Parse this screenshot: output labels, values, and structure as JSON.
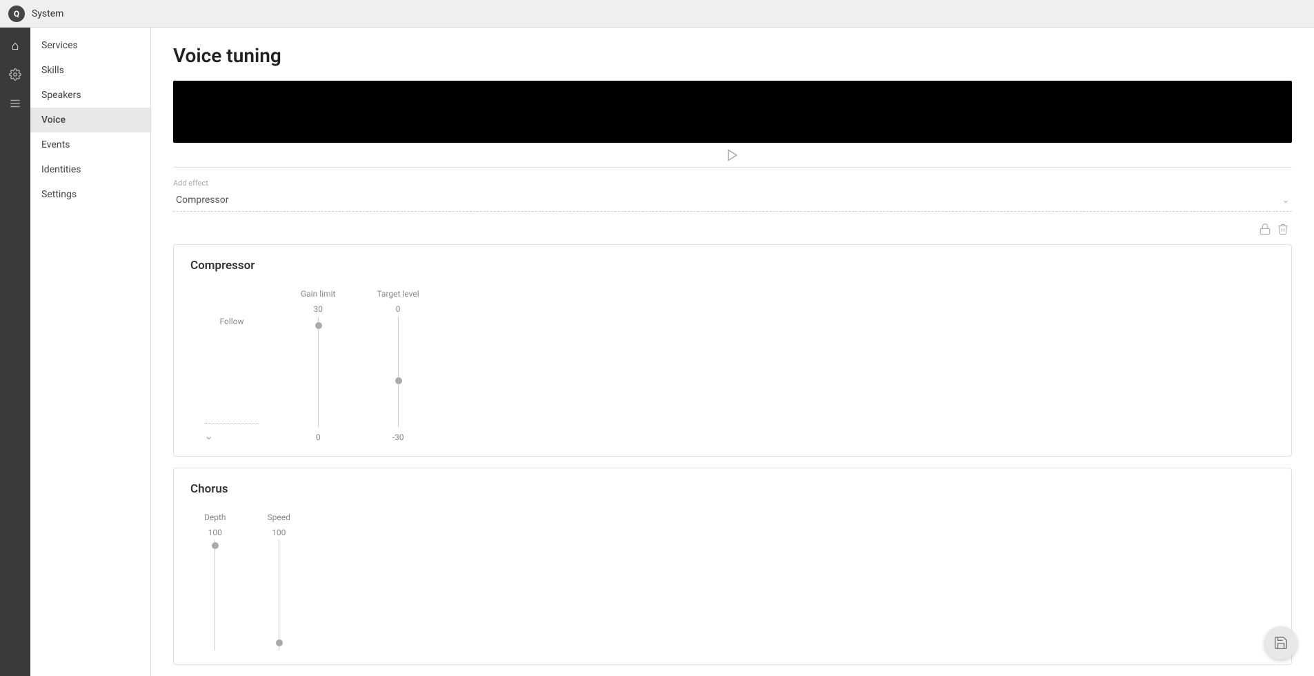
{
  "topbar": {
    "logo": "Q",
    "title": "System"
  },
  "sidebar_icons": [
    {
      "name": "home-icon",
      "symbol": "⌂",
      "active": true
    },
    {
      "name": "skills-icon",
      "symbol": "⚙",
      "active": false
    },
    {
      "name": "menu-icon",
      "symbol": "≡",
      "active": false
    }
  ],
  "nav": {
    "items": [
      {
        "label": "Services",
        "key": "services",
        "active": false
      },
      {
        "label": "Skills",
        "key": "skills",
        "active": false
      },
      {
        "label": "Speakers",
        "key": "speakers",
        "active": false
      },
      {
        "label": "Voice",
        "key": "voice",
        "active": true
      },
      {
        "label": "Events",
        "key": "events",
        "active": false
      },
      {
        "label": "Identities",
        "key": "identities",
        "active": false
      },
      {
        "label": "Settings",
        "key": "settings",
        "active": false
      }
    ]
  },
  "main": {
    "title": "Voice tuning",
    "add_effect_label": "Add effect",
    "add_effect_value": "Compressor",
    "compressor": {
      "title": "Compressor",
      "follow_label": "Follow",
      "gain_limit_label": "Gain limit",
      "gain_limit_top": "30",
      "gain_limit_bottom": "0",
      "gain_limit_thumb_pct": 5,
      "target_level_label": "Target level",
      "target_level_top": "0",
      "target_level_bottom": "-30",
      "target_level_thumb_pct": 55
    },
    "chorus": {
      "title": "Chorus",
      "depth_label": "Depth",
      "depth_value": "100",
      "speed_label": "Speed",
      "speed_value": "100",
      "depth_thumb_pct": 2,
      "speed_thumb_pct": 90
    }
  },
  "actions": {
    "lock_icon": "🔒",
    "delete_icon": "🗑",
    "save_icon": "💾",
    "play_icon": "▷"
  }
}
